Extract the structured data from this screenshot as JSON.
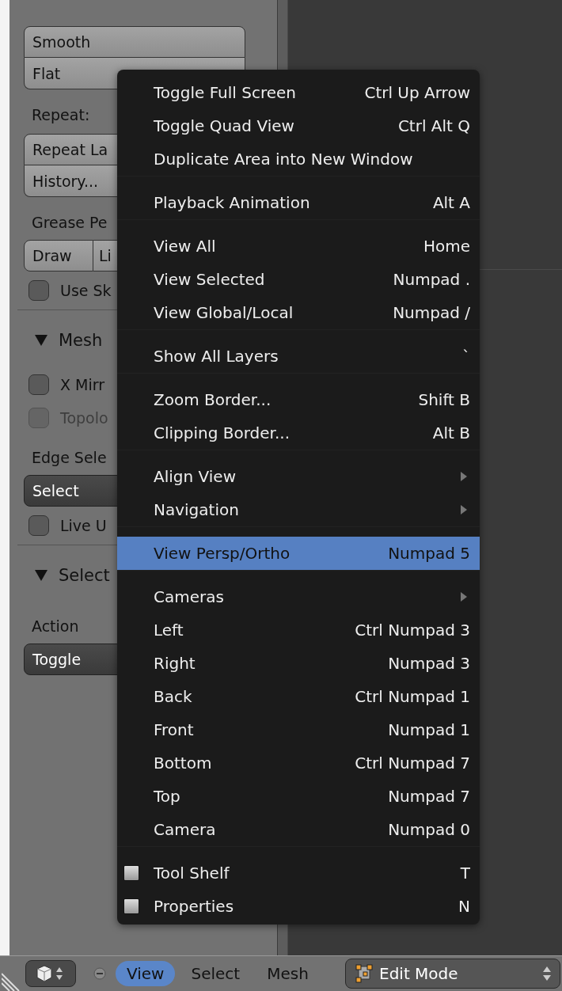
{
  "tool_shelf": [
    {
      "kind": "button_stack",
      "buttons": [
        "Smooth",
        "Flat"
      ]
    },
    {
      "kind": "label",
      "text": "Repeat:"
    },
    {
      "kind": "button_stack",
      "buttons": [
        "Repeat La",
        "History..."
      ]
    },
    {
      "kind": "label",
      "text": "Grease Pe"
    },
    {
      "kind": "button_row",
      "buttons": [
        "Draw",
        "Li"
      ]
    },
    {
      "kind": "checkbox",
      "label": "Use Sk",
      "checked": false,
      "disabled": false
    },
    {
      "kind": "panel_header",
      "label": "Mesh",
      "expanded": true
    },
    {
      "kind": "checkbox",
      "label": "X Mirr",
      "checked": false,
      "disabled": false
    },
    {
      "kind": "checkbox",
      "label": "Topolo",
      "checked": false,
      "disabled": true
    },
    {
      "kind": "label",
      "text": "Edge Sele"
    },
    {
      "kind": "dropdown",
      "value": "Select"
    },
    {
      "kind": "checkbox",
      "label": "Live U",
      "checked": false,
      "disabled": false
    },
    {
      "kind": "panel_header",
      "label": "Select",
      "expanded": true
    },
    {
      "kind": "label",
      "text": "Action"
    },
    {
      "kind": "dropdown",
      "value": "Toggle"
    }
  ],
  "view_menu": {
    "sections": [
      [
        {
          "kind": "item",
          "label": "Toggle Full Screen",
          "shortcut": "Ctrl Up Arrow",
          "selected": false
        },
        {
          "kind": "item",
          "label": "Toggle Quad View",
          "shortcut": "Ctrl Alt Q",
          "selected": false
        },
        {
          "kind": "item",
          "label": "Duplicate Area into New Window",
          "selected": false
        }
      ],
      [
        {
          "kind": "item",
          "label": "Playback Animation",
          "shortcut": "Alt A",
          "selected": false
        }
      ],
      [
        {
          "kind": "item",
          "label": "View All",
          "shortcut": "Home",
          "selected": false
        },
        {
          "kind": "item",
          "label": "View Selected",
          "shortcut": "Numpad .",
          "selected": false
        },
        {
          "kind": "item",
          "label": "View Global/Local",
          "shortcut": "Numpad /",
          "selected": false
        }
      ],
      [
        {
          "kind": "item",
          "label": "Show All Layers",
          "shortcut": "`",
          "selected": false
        }
      ],
      [
        {
          "kind": "item",
          "label": "Zoom Border...",
          "shortcut": "Shift B",
          "selected": false
        },
        {
          "kind": "item",
          "label": "Clipping Border...",
          "shortcut": "Alt B",
          "selected": false
        }
      ],
      [
        {
          "kind": "submenu",
          "label": "Align View",
          "selected": false
        },
        {
          "kind": "submenu",
          "label": "Navigation",
          "selected": false
        }
      ],
      [
        {
          "kind": "item",
          "label": "View Persp/Ortho",
          "shortcut": "Numpad 5",
          "selected": true
        }
      ],
      [
        {
          "kind": "submenu",
          "label": "Cameras",
          "selected": false
        },
        {
          "kind": "item",
          "label": "Left",
          "shortcut": "Ctrl Numpad 3",
          "selected": false
        },
        {
          "kind": "item",
          "label": "Right",
          "shortcut": "Numpad 3",
          "selected": false
        },
        {
          "kind": "item",
          "label": "Back",
          "shortcut": "Ctrl Numpad 1",
          "selected": false
        },
        {
          "kind": "item",
          "label": "Front",
          "shortcut": "Numpad 1",
          "selected": false
        },
        {
          "kind": "item",
          "label": "Bottom",
          "shortcut": "Ctrl Numpad 7",
          "selected": false
        },
        {
          "kind": "item",
          "label": "Top",
          "shortcut": "Numpad 7",
          "selected": false
        },
        {
          "kind": "item",
          "label": "Camera",
          "shortcut": "Numpad 0",
          "selected": false
        }
      ],
      [
        {
          "kind": "check",
          "label": "Tool Shelf",
          "shortcut": "T",
          "checked": false,
          "selected": false
        },
        {
          "kind": "check",
          "label": "Properties",
          "shortcut": "N",
          "checked": false,
          "selected": false
        }
      ]
    ]
  },
  "header_bar": {
    "menus": [
      {
        "label": "View",
        "selected": true
      },
      {
        "label": "Select",
        "selected": false
      },
      {
        "label": "Mesh",
        "selected": false
      }
    ],
    "mode": "Edit Mode"
  }
}
